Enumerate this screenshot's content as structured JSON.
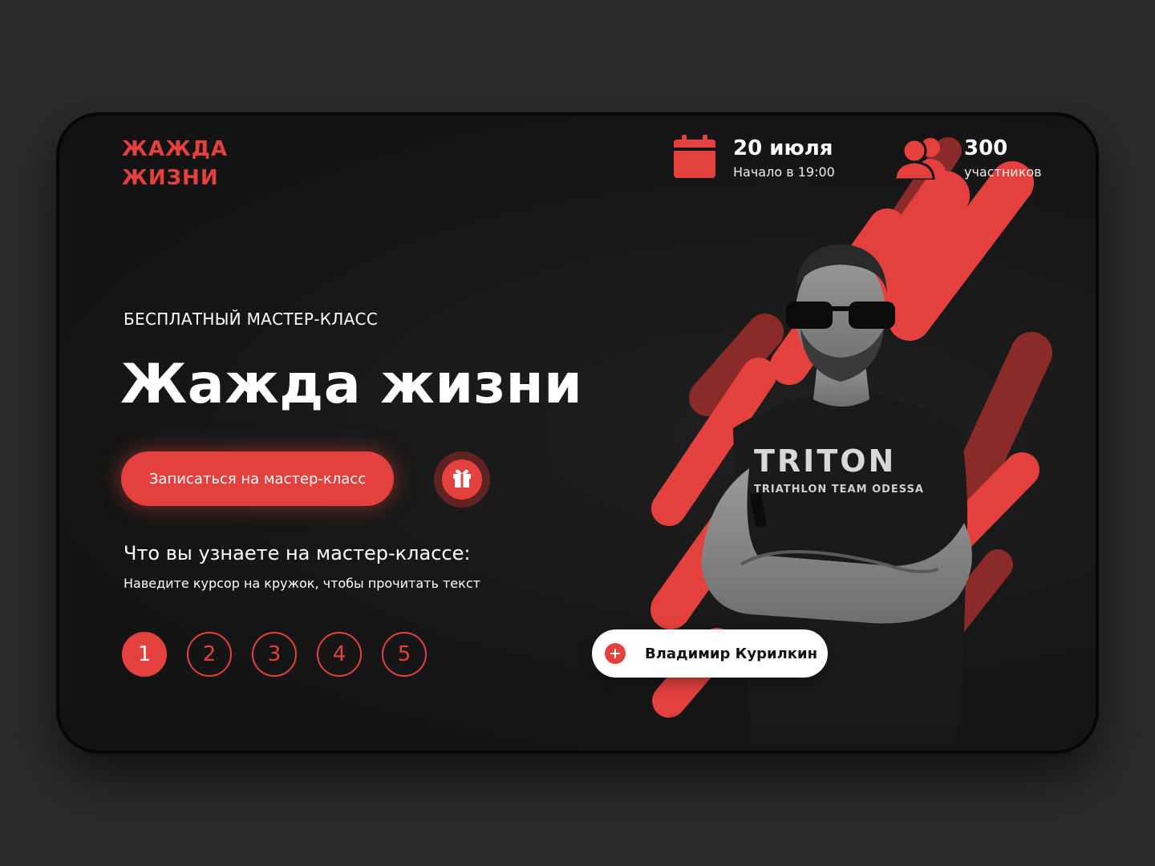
{
  "brand": {
    "line1": "ЖАЖДА",
    "line2": "ЖИЗНИ",
    "accent": "#e4403d"
  },
  "event": {
    "date": "20 июля",
    "start": "Начало в 19:00",
    "date_icon": "calendar-icon",
    "participants": "300",
    "participants_label": "участников",
    "participants_icon": "users-icon"
  },
  "hero": {
    "subtitle": "БЕСПЛАТНЫЙ МАСТЕР-КЛАСС",
    "title": "Жажда жизни",
    "cta_label": "Записаться на мастер-класс",
    "gift_icon": "gift-icon"
  },
  "learn": {
    "title": "Что вы узнаете на мастер-классе:",
    "hint": "Наведите курсор на кружок, чтобы прочитать текст",
    "steps": [
      "1",
      "2",
      "3",
      "4",
      "5"
    ],
    "active_step": "1"
  },
  "speaker": {
    "name": "Владимир Курилкин",
    "icon": "plus-icon",
    "shirt_line1": "TRITON",
    "shirt_line2": "TRIATHLON TEAM ODESSA"
  }
}
